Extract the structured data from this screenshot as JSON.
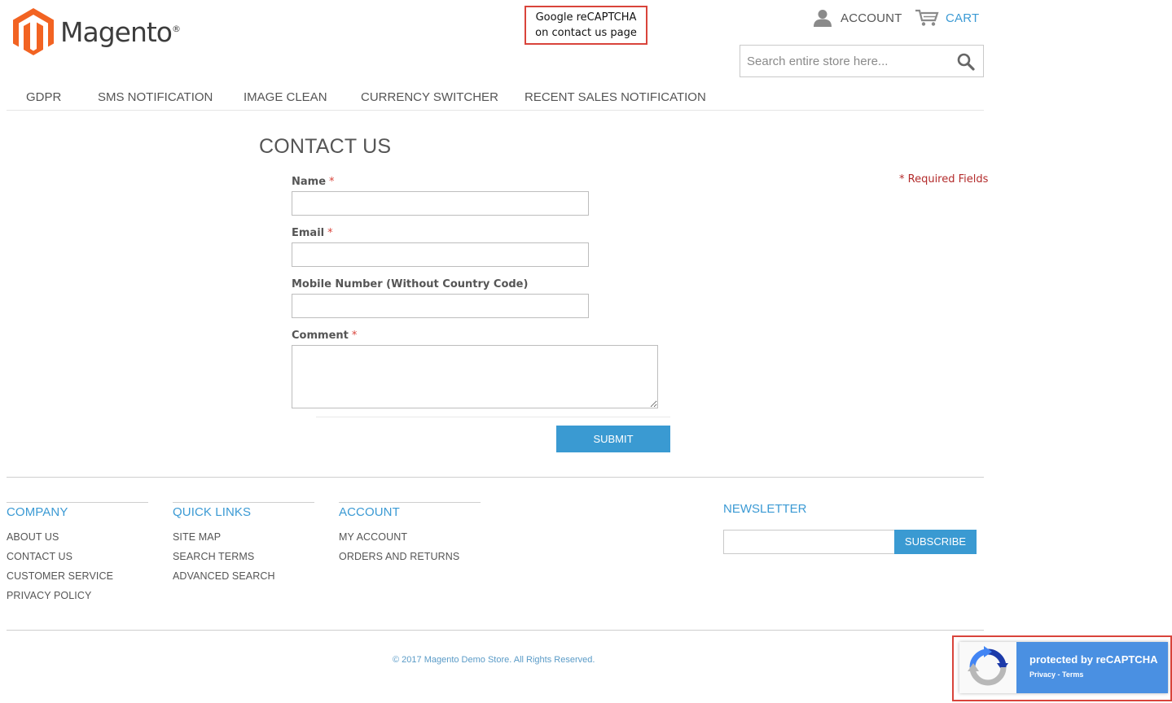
{
  "header": {
    "logo_text": "Magento",
    "logo_mark": "®",
    "annotation_line1": "Google reCAPTCHA",
    "annotation_line2": "on contact us page",
    "account_label": "ACCOUNT",
    "cart_label": "CART",
    "search_placeholder": "Search entire store here..."
  },
  "nav": {
    "items": [
      "GDPR",
      "SMS NOTIFICATION",
      "IMAGE CLEAN",
      "CURRENCY SWITCHER",
      "RECENT SALES NOTIFICATION"
    ]
  },
  "form": {
    "title": "CONTACT US",
    "required_note": "* Required Fields",
    "name_label": "Name",
    "email_label": "Email",
    "mobile_label": "Mobile Number (Without Country Code)",
    "comment_label": "Comment",
    "required_star": "*",
    "submit_label": "SUBMIT"
  },
  "footer": {
    "company": {
      "title": "COMPANY",
      "links": [
        "ABOUT US",
        "CONTACT US",
        "CUSTOMER SERVICE",
        "PRIVACY POLICY"
      ]
    },
    "quick_links": {
      "title": "QUICK LINKS",
      "links": [
        "SITE MAP",
        "SEARCH TERMS",
        "ADVANCED SEARCH"
      ]
    },
    "account": {
      "title": "ACCOUNT",
      "links": [
        "MY ACCOUNT",
        "ORDERS AND RETURNS"
      ]
    },
    "newsletter": {
      "title": "NEWSLETTER",
      "subscribe_label": "SUBSCRIBE"
    },
    "copyright": "© 2017 Magento Demo Store. All Rights Reserved."
  },
  "recaptcha": {
    "line1": "protected by reCAPTCHA",
    "line2": "Privacy - Terms"
  },
  "colors": {
    "accent": "#3a9ad2",
    "logo_orange": "#f26322",
    "annotation_red": "#d9443b",
    "required_red": "#b32b2b",
    "recaptcha_blue": "#4a90e2"
  },
  "icons": {
    "logo": "magento-logo-icon",
    "account": "user-icon",
    "cart": "cart-icon",
    "search": "search-icon",
    "recaptcha": "recaptcha-icon"
  }
}
